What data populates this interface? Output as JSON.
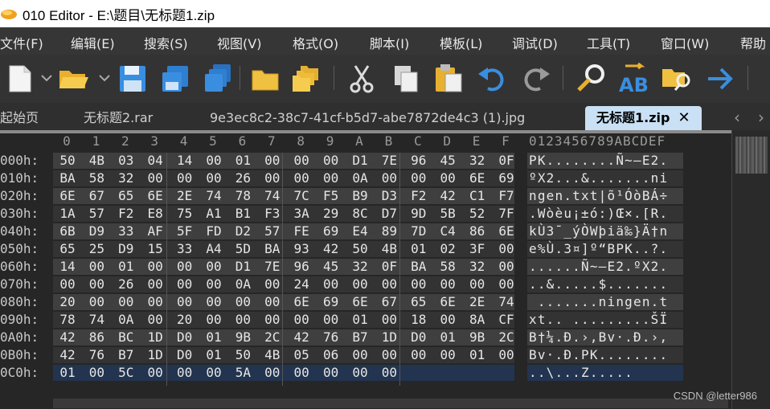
{
  "window": {
    "title": "010 Editor - E:\\题目\\无标题1.zip"
  },
  "menu": [
    "文件(F)",
    "编辑(E)",
    "搜索(S)",
    "视图(V)",
    "格式(O)",
    "脚本(I)",
    "模板(L)",
    "调试(D)",
    "工具(T)",
    "窗口(W)",
    "帮助"
  ],
  "toolbar_icons": [
    "new-file-icon",
    "open-folder-icon",
    "save-icon",
    "save-as-icon",
    "save-all-icon",
    "folder-icon",
    "open-multiple-icon",
    "cut-icon",
    "copy-icon",
    "paste-icon",
    "undo-icon",
    "redo-icon",
    "find-icon",
    "replace-icon",
    "find-in-files-icon",
    "goto-icon"
  ],
  "tabs": [
    {
      "label": "起始页",
      "active": false
    },
    {
      "label": "无标题2.rar",
      "active": false
    },
    {
      "label": "9e3ec8c2-38c7-41cf-b5d7-abe7872de4c3 (1).jpg",
      "active": false
    },
    {
      "label": "无标题1.zip",
      "active": true,
      "close": "✕"
    }
  ],
  "hex_view": {
    "column_headers": [
      "0",
      "1",
      "2",
      "3",
      "4",
      "5",
      "6",
      "7",
      "8",
      "9",
      "A",
      "B",
      "C",
      "D",
      "E",
      "F"
    ],
    "char_header": "0123456789ABCDEF",
    "rows": [
      {
        "addr": "000h:",
        "bytes": [
          "50",
          "4B",
          "03",
          "04",
          "14",
          "00",
          "01",
          "00",
          "00",
          "00",
          "D1",
          "7E",
          "96",
          "45",
          "32",
          "0F"
        ],
        "chars": "PK........Ñ~–E2."
      },
      {
        "addr": "010h:",
        "bytes": [
          "BA",
          "58",
          "32",
          "00",
          "00",
          "00",
          "26",
          "00",
          "00",
          "00",
          "0A",
          "00",
          "00",
          "00",
          "6E",
          "69"
        ],
        "chars": "ºX2...&.......ni"
      },
      {
        "addr": "020h:",
        "bytes": [
          "6E",
          "67",
          "65",
          "6E",
          "2E",
          "74",
          "78",
          "74",
          "7C",
          "F5",
          "B9",
          "D3",
          "F2",
          "42",
          "C1",
          "F7"
        ],
        "chars": "ngen.txt|õ¹ÓòBÁ÷"
      },
      {
        "addr": "030h:",
        "bytes": [
          "1A",
          "57",
          "F2",
          "E8",
          "75",
          "A1",
          "B1",
          "F3",
          "3A",
          "29",
          "8C",
          "D7",
          "9D",
          "5B",
          "52",
          "7F"
        ],
        "chars": ".Wòèu¡±ó:)Œ×.[R."
      },
      {
        "addr": "040h:",
        "bytes": [
          "6B",
          "D9",
          "33",
          "AF",
          "5F",
          "FD",
          "D2",
          "57",
          "FE",
          "69",
          "E4",
          "89",
          "7D",
          "C4",
          "86",
          "6E"
        ],
        "chars": "kÙ3¯_ýÒWþiä‰}Ä†n"
      },
      {
        "addr": "050h:",
        "bytes": [
          "65",
          "25",
          "D9",
          "15",
          "33",
          "A4",
          "5D",
          "BA",
          "93",
          "42",
          "50",
          "4B",
          "01",
          "02",
          "3F",
          "00"
        ],
        "chars": "e%Ù.3¤]º“BPK..?."
      },
      {
        "addr": "060h:",
        "bytes": [
          "14",
          "00",
          "01",
          "00",
          "00",
          "00",
          "D1",
          "7E",
          "96",
          "45",
          "32",
          "0F",
          "BA",
          "58",
          "32",
          "00"
        ],
        "chars": "......Ñ~–E2.ºX2."
      },
      {
        "addr": "070h:",
        "bytes": [
          "00",
          "00",
          "26",
          "00",
          "00",
          "00",
          "0A",
          "00",
          "24",
          "00",
          "00",
          "00",
          "00",
          "00",
          "00",
          "00"
        ],
        "chars": "..&.....$......."
      },
      {
        "addr": "080h:",
        "bytes": [
          "20",
          "00",
          "00",
          "00",
          "00",
          "00",
          "00",
          "00",
          "6E",
          "69",
          "6E",
          "67",
          "65",
          "6E",
          "2E",
          "74"
        ],
        "chars": " .......ningen.t"
      },
      {
        "addr": "090h:",
        "bytes": [
          "78",
          "74",
          "0A",
          "00",
          "20",
          "00",
          "00",
          "00",
          "00",
          "00",
          "01",
          "00",
          "18",
          "00",
          "8A",
          "CF"
        ],
        "chars": "xt.. .........ŠÏ"
      },
      {
        "addr": "0A0h:",
        "bytes": [
          "42",
          "86",
          "BC",
          "1D",
          "D0",
          "01",
          "9B",
          "2C",
          "42",
          "76",
          "B7",
          "1D",
          "D0",
          "01",
          "9B",
          "2C"
        ],
        "chars": "B†¼.Ð.›,Bv·.Ð.›,"
      },
      {
        "addr": "0B0h:",
        "bytes": [
          "42",
          "76",
          "B7",
          "1D",
          "D0",
          "01",
          "50",
          "4B",
          "05",
          "06",
          "00",
          "00",
          "00",
          "00",
          "01",
          "00"
        ],
        "chars": "Bv·.Ð.PK........"
      },
      {
        "addr": "0C0h:",
        "bytes": [
          "01",
          "00",
          "5C",
          "00",
          "00",
          "00",
          "5A",
          "00",
          "00",
          "00",
          "00",
          "00"
        ],
        "chars": "..\\...Z....."
      }
    ]
  },
  "watermark": "CSDN @letter986",
  "colors": {
    "row_a": "#3f3f3f",
    "row_b": "#333333",
    "row_selected": "#22344f",
    "tab_active": "#c9e0f5"
  }
}
